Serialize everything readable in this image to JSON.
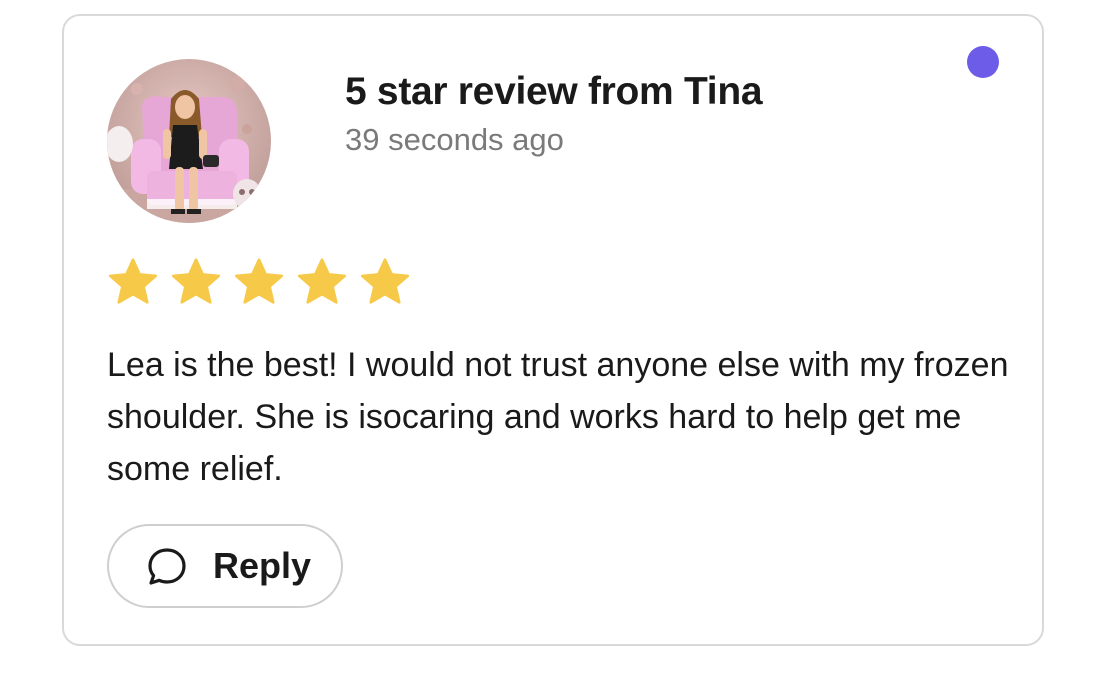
{
  "notification": {
    "title": "5 star review from Tina",
    "time": "39 seconds ago",
    "unread": true,
    "unread_color": "#6c5ce7"
  },
  "rating": {
    "stars": 5,
    "max": 5,
    "star_color": "#f7c948",
    "icon": "star-icon"
  },
  "review": {
    "text": "Lea is the best! I would not trust anyone else with my frozen shoulder. She is isocaring and works hard to help get me some relief."
  },
  "actions": {
    "reply_label": "Reply",
    "reply_icon": "speech-bubble-icon"
  },
  "avatar": {
    "icon": "reviewer-avatar"
  }
}
